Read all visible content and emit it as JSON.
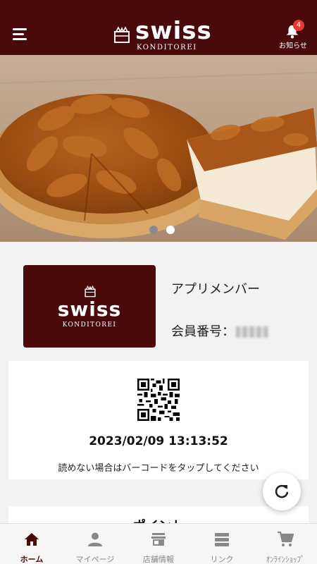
{
  "header": {
    "brand_name": "swiss",
    "brand_sub": "KONDITOREI",
    "notification_count": "4",
    "notification_label": "お知らせ"
  },
  "carousel": {
    "total": 2,
    "active": 2
  },
  "member": {
    "card_brand": "swiss",
    "card_sub": "KONDITOREI",
    "name": "アプリメンバー",
    "number_label": "会員番号："
  },
  "qr": {
    "datetime": "2023/02/09 13:13:52",
    "help_text": "読めない場合はバーコードをタップしてください"
  },
  "points": {
    "title": "ポイント"
  },
  "nav": {
    "items": [
      {
        "label": "ホーム",
        "icon": "home-icon",
        "active": true
      },
      {
        "label": "マイページ",
        "icon": "person-icon",
        "active": false
      },
      {
        "label": "店舗情報",
        "icon": "store-icon",
        "active": false
      },
      {
        "label": "リンク",
        "icon": "list-icon",
        "active": false
      },
      {
        "label": "ｵﾝﾗｲﾝｼｮｯﾌﾟ",
        "icon": "cart-icon",
        "active": false
      }
    ]
  },
  "colors": {
    "brand": "#4a0a0a",
    "badge": "#e53935",
    "nav_inactive": "#888888"
  }
}
